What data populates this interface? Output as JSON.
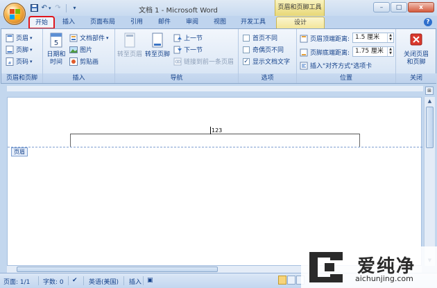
{
  "title_bar": {
    "title": "文档 1 - Microsoft Word",
    "context_tab_group": "页眉和页脚工具",
    "window_buttons": [
      "–",
      "□",
      "x"
    ]
  },
  "quick_access": {
    "undo_icon": "↶",
    "redo_icon": "↷"
  },
  "tabs": [
    {
      "label": "开始"
    },
    {
      "label": "插入"
    },
    {
      "label": "页面布局"
    },
    {
      "label": "引用"
    },
    {
      "label": "邮件"
    },
    {
      "label": "审阅"
    },
    {
      "label": "视图"
    },
    {
      "label": "开发工具"
    },
    {
      "label": "设计"
    }
  ],
  "ribbon": {
    "header_footer_group": {
      "label": "页眉和页脚",
      "header": "页眉",
      "footer": "页脚",
      "page_number": "页码"
    },
    "insert_group": {
      "label": "插入",
      "date_time": "日期和时间",
      "quick_parts": "文档部件",
      "picture": "图片",
      "clip_art": "剪贴画"
    },
    "navigation_group": {
      "label": "导航",
      "goto_header": "转至页眉",
      "goto_footer": "转至页脚",
      "previous": "上一节",
      "next": "下一节",
      "link_previous": "链接到前一条页眉"
    },
    "options_group": {
      "label": "选项",
      "different_first": "首页不同",
      "different_odd_even": "奇偶页不同",
      "show_document_text": "显示文档文字",
      "checked_mark": "✓"
    },
    "position_group": {
      "label": "位置",
      "header_from_top": "页眉顶端距离:",
      "header_from_top_value": "1.5 厘米",
      "footer_from_bottom": "页脚底端距离:",
      "footer_from_bottom_value": "1.75 厘米",
      "insert_alignment_tab": "插入\"对齐方式\"选项卡"
    },
    "close_group": {
      "label": "关闭",
      "close_header_footer": "关闭页眉和页脚"
    }
  },
  "document": {
    "header_text": "123",
    "header_tag": "页眉"
  },
  "status_bar": {
    "page": "页面: 1/1",
    "word_count": "字数: 0",
    "language": "英语(美国)",
    "mode": "插入"
  },
  "watermark": {
    "text": "爱纯净",
    "url": "aichunjing.com"
  }
}
